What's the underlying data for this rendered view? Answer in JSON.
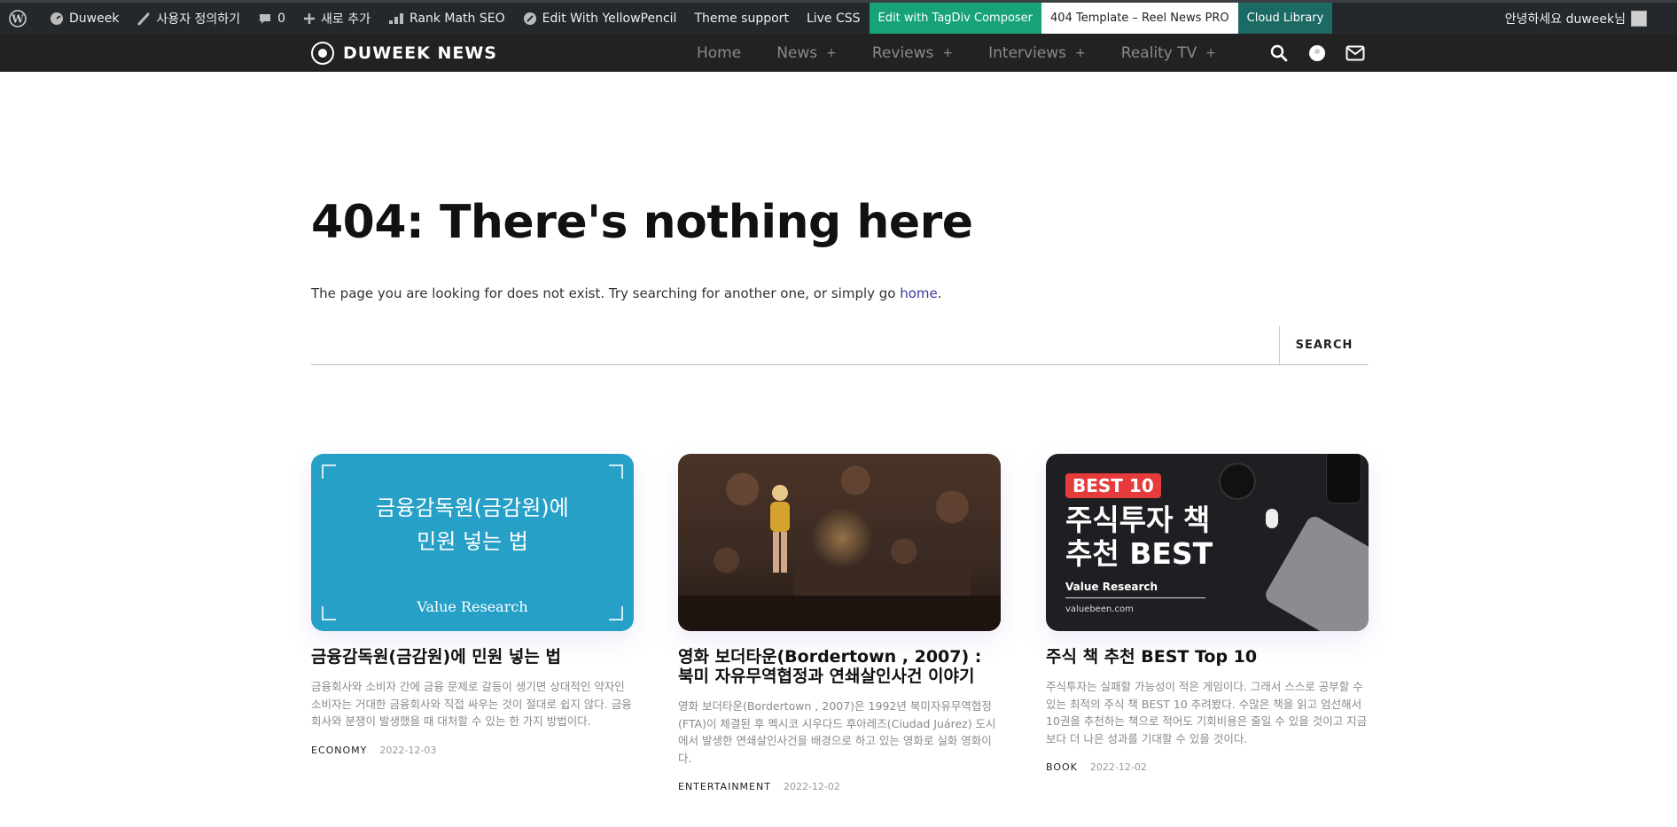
{
  "adminbar": {
    "site": "Duweek",
    "customize": "사용자 정의하기",
    "comments": "0",
    "new": "새로 추가",
    "rankmath": "Rank Math SEO",
    "yellowpencil": "Edit With YellowPencil",
    "theme_support": "Theme support",
    "live_css": "Live CSS",
    "tagdiv": "Edit with TagDiv Composer",
    "template": "404 Template – Reel News PRO",
    "cloud": "Cloud Library",
    "greeting": "안녕하세요 duweek님"
  },
  "header": {
    "logo": "DUWEEK NEWS",
    "nav": [
      {
        "label": "Home",
        "plus": ""
      },
      {
        "label": "News",
        "plus": "+"
      },
      {
        "label": "Reviews",
        "plus": "+"
      },
      {
        "label": "Interviews",
        "plus": "+"
      },
      {
        "label": "Reality TV",
        "plus": "+"
      }
    ]
  },
  "page": {
    "title": "404: There's nothing here",
    "desc_prefix": "The page you are looking for does not exist. Try searching for another one, or simply go ",
    "desc_link": "home",
    "desc_suffix": ".",
    "search_placeholder": "",
    "search_button": "SEARCH"
  },
  "cards": [
    {
      "thumb_line1": "금융감독원(금감원)에",
      "thumb_line2": "민원 넣는 법",
      "thumb_brand": "Value Research",
      "title": "금융감독원(금감원)에 민원 넣는 법",
      "excerpt": "금융회사와 소비자 간에 금융 문제로 갈등이 생기면 상대적인 약자인 소비자는 거대한 금융회사와 직접 싸우는 것이 절대로 쉽지 않다. 금융회사와 분쟁이 발생했을 때 대처할 수 있는 한 가지 방법이다.",
      "category": "ECONOMY",
      "date": "2022-12-03"
    },
    {
      "title": "영화 보더타운(Bordertown , 2007) : 북미 자유무역협정과 연쇄살인사건 이야기",
      "excerpt": "영화 보더타운(Bordertown , 2007)은 1992년 북미자유무역협정(FTA)이 체결된 후 멕시코 시우다드 후아레즈(Ciudad Juárez) 도시에서 발생한 연쇄살인사건을 배경으로 하고 있는 영화로 실화 영화이다.",
      "category": "ENTERTAINMENT",
      "date": "2022-12-02"
    },
    {
      "thumb_badge": "BEST 10",
      "thumb_line1": "주식투자 책",
      "thumb_line2": "추천 BEST",
      "thumb_brand": "Value Research",
      "thumb_site": "valuebeen.com",
      "title": "주식 책 추천 BEST Top 10",
      "excerpt": "주식투자는 실패할 가능성이 적은 게임이다. 그래서 스스로 공부할 수 있는 최적의 주식 책 BEST 10 추려봤다. 수많은 책을 읽고 엄선해서 10권을 추천하는 책으로 적어도 기회비용은 줄일 수 있을 것이고 지금보다 더 나은 성과를 기대할 수 있을 것이다.",
      "category": "BOOK",
      "date": "2022-12-02"
    }
  ]
}
